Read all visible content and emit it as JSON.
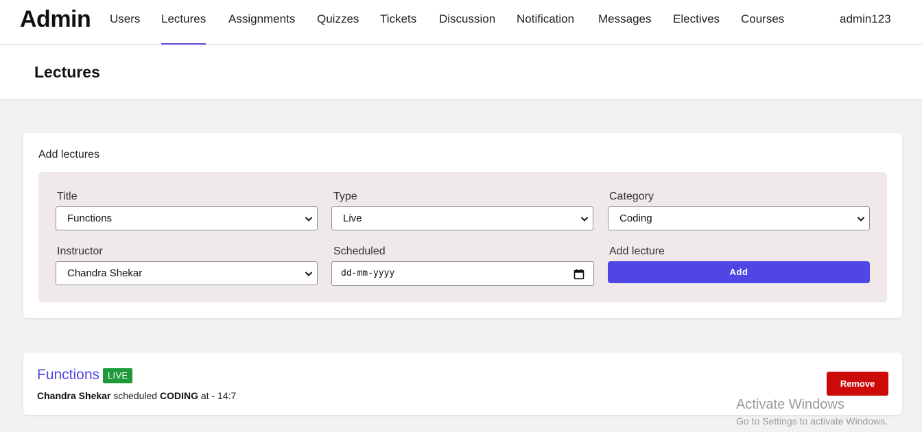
{
  "nav": {
    "brand": "Admin",
    "links": [
      "Users",
      "Lectures",
      "Assignments",
      "Quizzes",
      "Tickets",
      "Discussion",
      "Notification",
      "Messages",
      "Electives",
      "Courses"
    ],
    "active": "Lectures",
    "user": "admin123"
  },
  "page": {
    "title": "Lectures"
  },
  "add_form": {
    "heading": "Add lectures",
    "title_label": "Title",
    "title_value": "Functions",
    "type_label": "Type",
    "type_value": "Live",
    "category_label": "Category",
    "category_value": "Coding",
    "instructor_label": "Instructor",
    "instructor_value": "Chandra Shekar",
    "scheduled_label": "Scheduled",
    "scheduled_placeholder": "dd-mm-yyyy",
    "add_lecture_label": "Add lecture",
    "add_button": "Add"
  },
  "lectures": [
    {
      "title": "Functions",
      "badge": "LIVE",
      "instructor": "Chandra Shekar",
      "scheduled_text": "scheduled",
      "category": "CODING",
      "at_text": "at - 14:7",
      "remove_button": "Remove"
    }
  ],
  "watermark": {
    "title": "Activate Windows",
    "subtitle": "Go to Settings to activate Windows."
  },
  "colors": {
    "accent": "#5046e5",
    "live_badge": "#1e9a3a",
    "remove": "#cc0a0a"
  }
}
